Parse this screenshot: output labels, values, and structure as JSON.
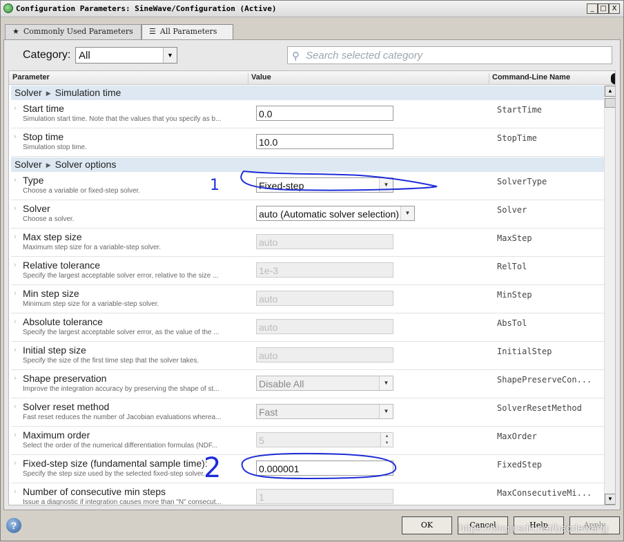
{
  "window": {
    "title": "Configuration Parameters: SineWave/Configuration (Active)",
    "controls": {
      "minimize": "_",
      "maximize": "□",
      "close": "X"
    }
  },
  "tabs": [
    {
      "icon": "star-icon",
      "glyph": "★",
      "label": "Commonly Used Parameters",
      "active": false
    },
    {
      "icon": "list-icon",
      "glyph": "☰",
      "label": "All Parameters",
      "active": true
    }
  ],
  "category": {
    "label": "Category:",
    "value": "All"
  },
  "search": {
    "placeholder": "Search selected category"
  },
  "columns": {
    "parameter": "Parameter",
    "value": "Value",
    "command": "Command-Line Name"
  },
  "sections": {
    "sim_time": {
      "group": "Solver",
      "name": "Simulation time"
    },
    "solver_options": {
      "group": "Solver",
      "name": "Solver options"
    }
  },
  "rows": {
    "start_time": {
      "name": "Start time",
      "desc": "Simulation start time. Note that the values that you specify as b...",
      "value": "0.0",
      "cmd": "StartTime"
    },
    "stop_time": {
      "name": "Stop time",
      "desc": "Simulation stop time.",
      "value": "10.0",
      "cmd": "StopTime"
    },
    "type": {
      "name": "Type",
      "desc": "Choose a variable or fixed-step solver.",
      "value": "Fixed-step",
      "cmd": "SolverType"
    },
    "solver": {
      "name": "Solver",
      "desc": "Choose a solver.",
      "value": "auto (Automatic solver selection)",
      "cmd": "Solver"
    },
    "max_step": {
      "name": "Max step size",
      "desc": "Maximum step size for a variable-step solver.",
      "value": "auto",
      "cmd": "MaxStep"
    },
    "rel_tol": {
      "name": "Relative tolerance",
      "desc": "Specify the largest acceptable solver error, relative to the size ...",
      "value": "1e-3",
      "cmd": "RelTol"
    },
    "min_step": {
      "name": "Min step size",
      "desc": "Minimum step size for a variable-step solver.",
      "value": "auto",
      "cmd": "MinStep"
    },
    "abs_tol": {
      "name": "Absolute tolerance",
      "desc": "Specify the largest acceptable solver error, as the value of the ...",
      "value": "auto",
      "cmd": "AbsTol"
    },
    "init_step": {
      "name": "Initial step size",
      "desc": "Specify the size of the first time step that the solver takes.",
      "value": "auto",
      "cmd": "InitialStep"
    },
    "shape": {
      "name": "Shape preservation",
      "desc": "Improve the integration accuracy by preserving the shape of st...",
      "value": "Disable All",
      "cmd": "ShapePreserveCon..."
    },
    "reset": {
      "name": "Solver reset method",
      "desc": "Fast reset reduces the number of Jacobian evaluations wherea...",
      "value": "Fast",
      "cmd": "SolverResetMethod"
    },
    "max_order": {
      "name": "Maximum order",
      "desc": "Select the order of the numerical differentiation formulas (NDF...",
      "value": "5",
      "cmd": "MaxOrder"
    },
    "fixed_step": {
      "name": "Fixed-step size (fundamental sample time):",
      "desc": "Specify the step size used by the selected fixed-step solver.",
      "value": "0.000001",
      "cmd": "FixedStep"
    },
    "consec_min": {
      "name": "Number of consecutive min steps",
      "desc": "Issue a diagnostic if integration causes more than \"N\" consecut...",
      "value": "1",
      "cmd": "MaxConsecutiveMi..."
    }
  },
  "buttons": {
    "ok": "OK",
    "cancel": "Cancel",
    "help": "Help",
    "apply": "Apply"
  },
  "annotations": {
    "mark1": "1",
    "mark2": "2"
  },
  "watermark": "https://blog.csdn.net/baodewang"
}
